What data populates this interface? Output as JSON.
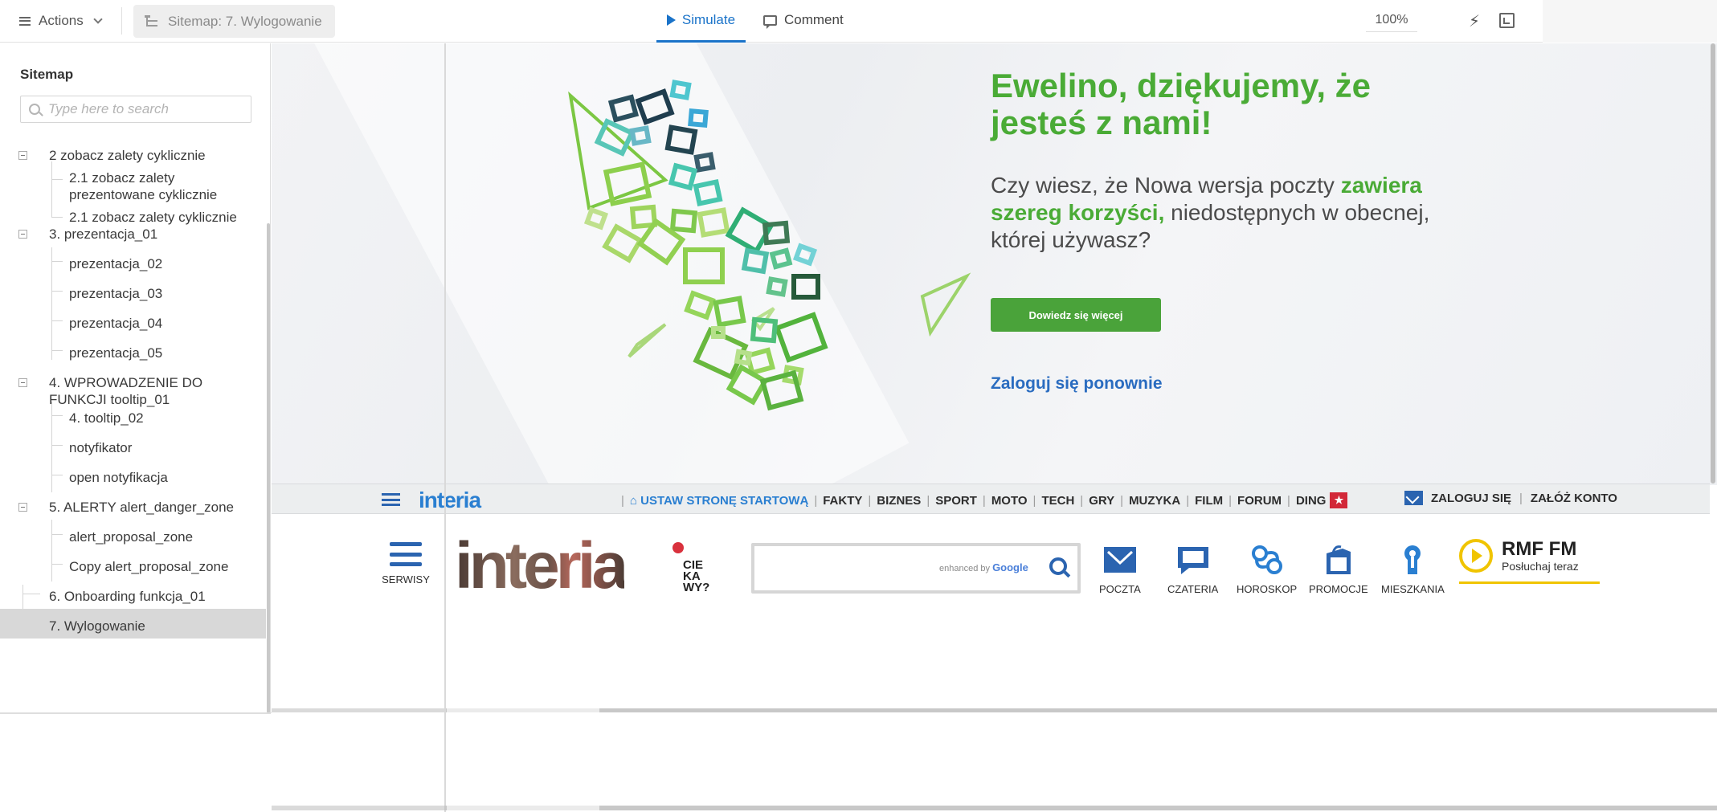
{
  "toolbar": {
    "actions_label": "Actions",
    "breadcrumb": "Sitemap: 7. Wylogowanie",
    "tabs": [
      {
        "label": "Simulate",
        "active": true
      },
      {
        "label": "Comment",
        "active": false
      }
    ],
    "zoom": "100%",
    "accent_color": "#1a73c9"
  },
  "sidebar": {
    "title": "Sitemap",
    "search_placeholder": "Type here to search",
    "search_value": "",
    "items": [
      {
        "label": "2 zobacz zalety cyklicznie",
        "level": 0,
        "expandable": true
      },
      {
        "label": "2.1 zobacz zalety prezentowane cyklicznie",
        "level": 1
      },
      {
        "label": "2.1 zobacz zalety cyklicznie",
        "level": 1
      },
      {
        "label": "3. prezentacja_01",
        "level": 0,
        "expandable": true
      },
      {
        "label": "prezentacja_02",
        "level": 1
      },
      {
        "label": "prezentacja_03",
        "level": 1
      },
      {
        "label": "prezentacja_04",
        "level": 1
      },
      {
        "label": "prezentacja_05",
        "level": 1
      },
      {
        "label": "4. WPROWADZENIE DO FUNKCJI tooltip_01",
        "level": 0,
        "expandable": true
      },
      {
        "label": "4. tooltip_02",
        "level": 1
      },
      {
        "label": "notyfikator",
        "level": 1
      },
      {
        "label": "open notyfikacja",
        "level": 1
      },
      {
        "label": "5. ALERTY alert_danger_zone",
        "level": 0,
        "expandable": true
      },
      {
        "label": "alert_proposal_zone",
        "level": 1
      },
      {
        "label": "Copy alert_proposal_zone",
        "level": 1
      },
      {
        "label": "6. Onboarding funkcja_01",
        "level": 0
      },
      {
        "label": "7. Wylogowanie",
        "level": 0,
        "selected": true
      }
    ]
  },
  "hero": {
    "title": "Ewelino, dziękujemy, że jesteś z nami!",
    "text_before": "Czy wiesz, że Nowa wersja poczty ",
    "text_highlight": "zawiera szereg korzyści,",
    "text_after": " niedostępnych w obecnej, której używasz?",
    "button_label": "Dowiedz się więcej",
    "login_link": "Zaloguj się ponownie",
    "green_color": "#4aab36"
  },
  "interia_nav": {
    "logo": "interia",
    "links": [
      "USTAW STRONĘ STARTOWĄ",
      "FAKTY",
      "BIZNES",
      "SPORT",
      "MOTO",
      "TECH",
      "GRY",
      "MUZYKA",
      "FILM",
      "FORUM",
      "DING"
    ],
    "login": "ZALOGUJ SIĘ",
    "register": "ZAŁÓŻ KONTO"
  },
  "interia_header": {
    "serwisy": "SERWISY",
    "logo": "interia",
    "logo_tag": [
      "CIE",
      "KA",
      "WY?"
    ],
    "search_brand_prefix": "enhanced by",
    "search_brand": "Google",
    "services": [
      "POCZTA",
      "CZATERIA",
      "HOROSKOP",
      "PROMOCJE",
      "MIESZKANIA"
    ],
    "radio_title": "RMF FM",
    "radio_sub": "Posłuchaj teraz"
  }
}
